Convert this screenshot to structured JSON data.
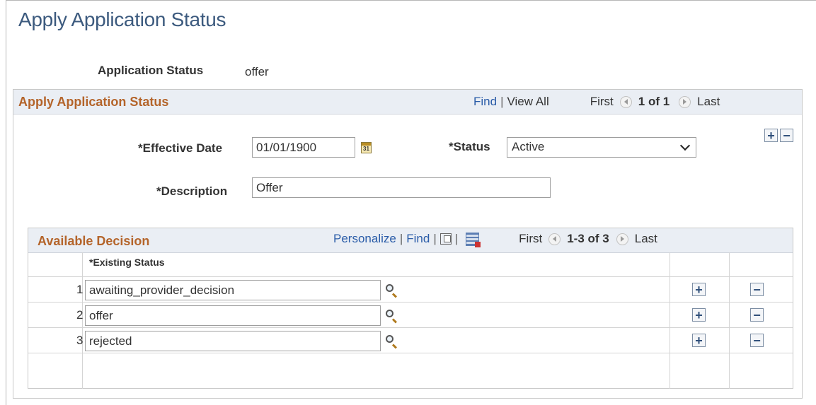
{
  "page": {
    "title": "Apply Application Status"
  },
  "summary": {
    "label": "Application Status",
    "value": "offer"
  },
  "group": {
    "title": "Apply Application Status",
    "find_label": "Find",
    "view_all_label": "View All",
    "first_label": "First",
    "count": "1 of 1",
    "last_label": "Last"
  },
  "form": {
    "effective_date_label": "*Effective Date",
    "effective_date_value": "01/01/1900",
    "status_label": "*Status",
    "status_value": "Active",
    "description_label": "*Description",
    "description_value": "Offer"
  },
  "grid": {
    "title": "Available Decision",
    "personalize_label": "Personalize",
    "find_label": "Find",
    "first_label": "First",
    "count": "1-3 of 3",
    "last_label": "Last",
    "column_header": "*Existing Status",
    "rows": [
      {
        "num": "1",
        "value": "awaiting_provider_decision"
      },
      {
        "num": "2",
        "value": "offer"
      },
      {
        "num": "3",
        "value": "rejected"
      }
    ]
  },
  "icons": {
    "add": "plus-icon",
    "remove": "minus-icon",
    "calendar": "calendar-icon",
    "lookup": "magnifier-icon"
  },
  "colors": {
    "title": "#3c5a7e",
    "group_title": "#b4642a",
    "link": "#2a5ca8",
    "header_bg": "#eaeef4"
  }
}
